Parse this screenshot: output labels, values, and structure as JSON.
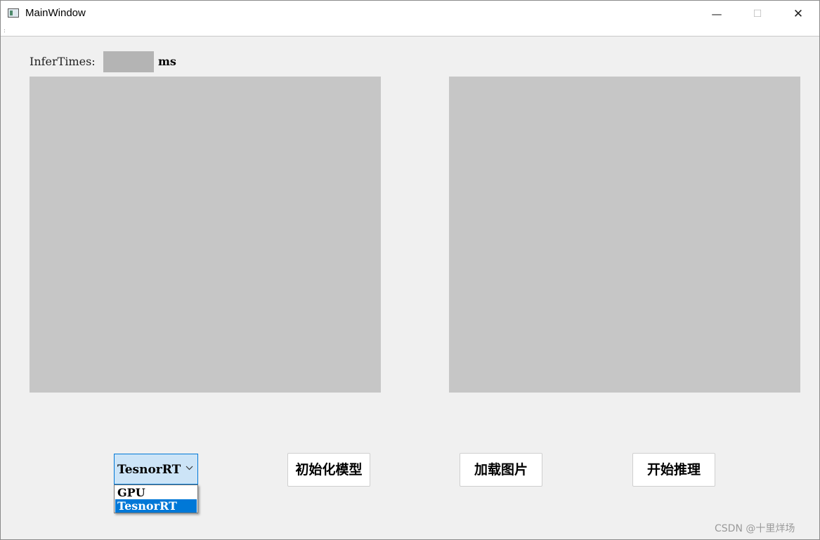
{
  "window": {
    "title": "MainWindow",
    "minimize_glyph": "—",
    "maximize_glyph": "☐",
    "close_glyph": "✕"
  },
  "menubar": {
    "grip": ":"
  },
  "infer": {
    "label": "InferTimes:",
    "value": "",
    "unit": "ms"
  },
  "images": {
    "left_color": "#c6c6c6",
    "right_color": "#c6c6c6"
  },
  "combo": {
    "selected": "TesnorRT",
    "arrow_icon": "chevron-down-icon",
    "options": [
      "GPU",
      "TesnorRT"
    ],
    "highlight_color": "#0078d7"
  },
  "buttons": {
    "init_label": "初始化模型",
    "load_label": "加载图片",
    "run_label": "开始推理"
  },
  "watermark": "CSDN @十里烊场"
}
